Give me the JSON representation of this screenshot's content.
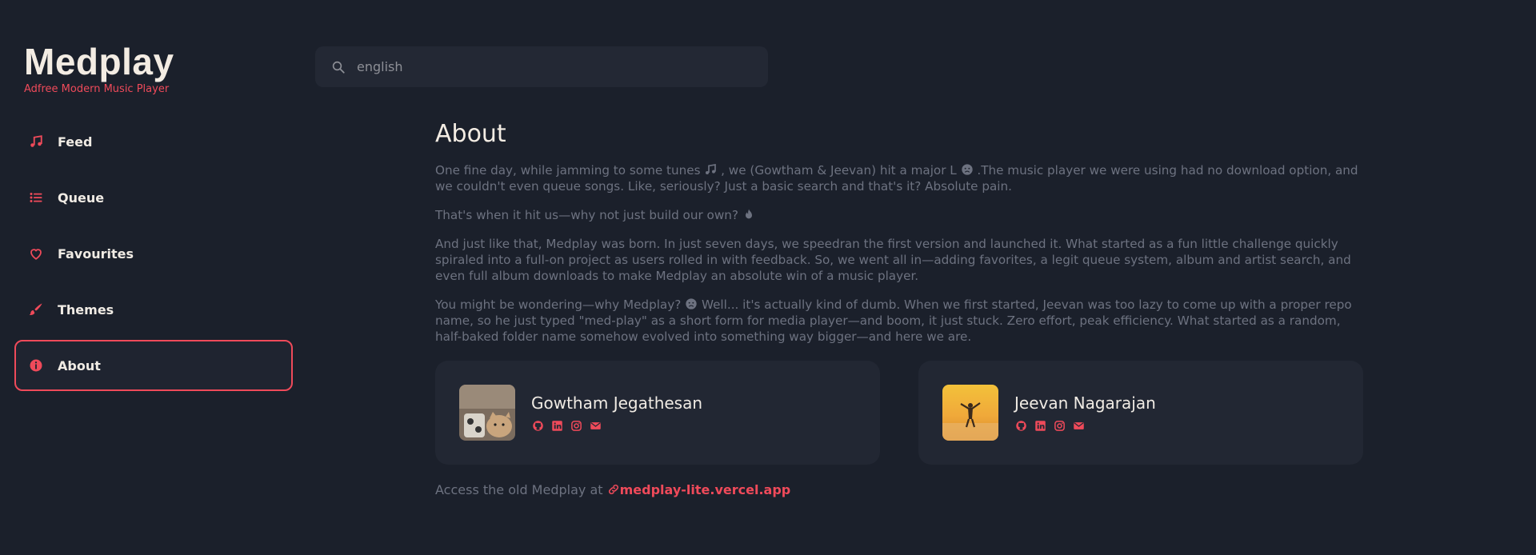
{
  "brand": {
    "title": "Medplay",
    "tagline": "Adfree Modern Music Player"
  },
  "nav": {
    "items": [
      {
        "label": "Feed",
        "icon": "music-note-icon"
      },
      {
        "label": "Queue",
        "icon": "list-icon"
      },
      {
        "label": "Favourites",
        "icon": "heart-icon"
      },
      {
        "label": "Themes",
        "icon": "brush-icon"
      },
      {
        "label": "About",
        "icon": "info-icon",
        "active": true
      }
    ]
  },
  "search": {
    "value": "english",
    "placeholder": "english"
  },
  "about": {
    "title": "About",
    "p1a": "One fine day, while jamming to some tunes",
    "p1b": ", we (Gowtham & Jeevan) hit a major L",
    "p1c": ".The music player we were using had no download option, and we couldn't even queue songs. Like, seriously? Just a basic search and that's it? Absolute pain.",
    "p2": "That's when it hit us—why not just build our own?",
    "p3": "And just like that, Medplay was born. In just seven days, we speedran the first version and launched it. What started as a fun little challenge quickly spiraled into a full-on project as users rolled in with feedback. So, we went all in—adding favorites, a legit queue system, album and artist search, and even full album downloads to make Medplay an absolute win of a music player.",
    "p4a": "You might be wondering—why Medplay?",
    "p4b": "Well... it's actually kind of dumb. When we first started, Jeevan was too lazy to come up with a proper repo name, so he just typed \"med-play\" as a short form for media player—and boom, it just stuck. Zero effort, peak efficiency. What started as a random, half-baked folder name somehow evolved into something way bigger—and here we are."
  },
  "authors": [
    {
      "name": "Gowtham Jegathesan",
      "socials": [
        "github-icon",
        "linkedin-icon",
        "instagram-icon",
        "mail-icon"
      ]
    },
    {
      "name": "Jeevan Nagarajan",
      "socials": [
        "github-icon",
        "linkedin-icon",
        "instagram-icon",
        "mail-icon"
      ]
    }
  ],
  "footer": {
    "prefix": "Access the old Medplay at",
    "link": "medplay-lite.vercel.app"
  },
  "colors": {
    "accent": "#ef4a5a",
    "background": "#1b202b",
    "card": "#222733"
  }
}
